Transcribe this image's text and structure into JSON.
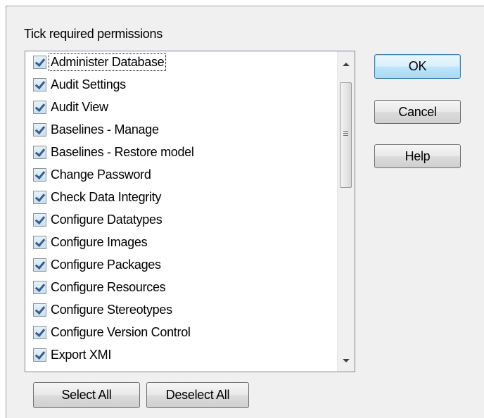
{
  "dialog": {
    "prompt": "Tick required permissions",
    "permissions": [
      {
        "label": "Administer Database",
        "checked": true
      },
      {
        "label": "Audit Settings",
        "checked": true
      },
      {
        "label": "Audit View",
        "checked": true
      },
      {
        "label": "Baselines - Manage",
        "checked": true
      },
      {
        "label": "Baselines - Restore model",
        "checked": true
      },
      {
        "label": "Change Password",
        "checked": true
      },
      {
        "label": "Check Data Integrity",
        "checked": true
      },
      {
        "label": "Configure Datatypes",
        "checked": true
      },
      {
        "label": "Configure Images",
        "checked": true
      },
      {
        "label": "Configure Packages",
        "checked": true
      },
      {
        "label": "Configure Resources",
        "checked": true
      },
      {
        "label": "Configure Stereotypes",
        "checked": true
      },
      {
        "label": "Configure Version Control",
        "checked": true
      },
      {
        "label": "Export XMI",
        "checked": true
      }
    ],
    "buttons": {
      "ok": "OK",
      "cancel": "Cancel",
      "help": "Help",
      "select_all": "Select All",
      "deselect_all": "Deselect All"
    }
  }
}
